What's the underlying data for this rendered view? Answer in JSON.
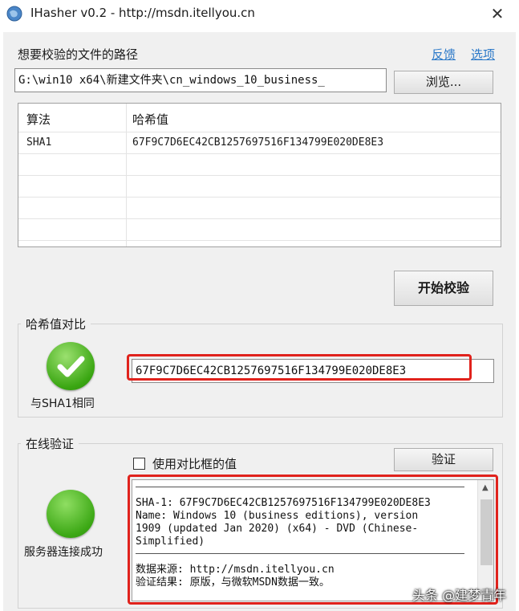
{
  "window": {
    "title": "IHasher v0.2 - http://msdn.itellyou.cn",
    "close_glyph": "✕"
  },
  "file": {
    "label": "想要校验的文件的路径",
    "feedback_link": "反馈",
    "options_link": "选项",
    "path_value": "G:\\win10 x64\\新建文件夹\\cn_windows_10_business_",
    "browse_label": "浏览..."
  },
  "hash_table": {
    "headers": [
      "算法",
      "哈希值"
    ],
    "rows": [
      {
        "algorithm": "SHA1",
        "hash": "67F9C7D6EC42CB1257697516F134799E020DE8E3"
      }
    ]
  },
  "start_button": "开始校验",
  "compare": {
    "group_title": "哈希值对比",
    "input_value": "67F9C7D6EC42CB1257697516F134799E020DE8E3",
    "status_text": "与SHA1相同",
    "status_icon": "check-circle-icon",
    "highlight_color": "#e0221c"
  },
  "online": {
    "group_title": "在线验证",
    "checkbox_label": "使用对比框的值",
    "checkbox_checked": false,
    "verify_label": "验证",
    "status_text": "服务器连接成功",
    "status_icon": "green-status-icon",
    "result_lines": [
      "SHA-1: 67F9C7D6EC42CB1257697516F134799E020DE8E3",
      "Name: Windows 10 (business editions), version",
      "1909 (updated Jan 2020) (x64) - DVD (Chinese-",
      "Simplified)",
      "数据来源: http://msdn.itellyou.cn",
      "验证结果: 原版，与微软MSDN数据一致。"
    ]
  },
  "watermark": "头条 @建梦青年"
}
